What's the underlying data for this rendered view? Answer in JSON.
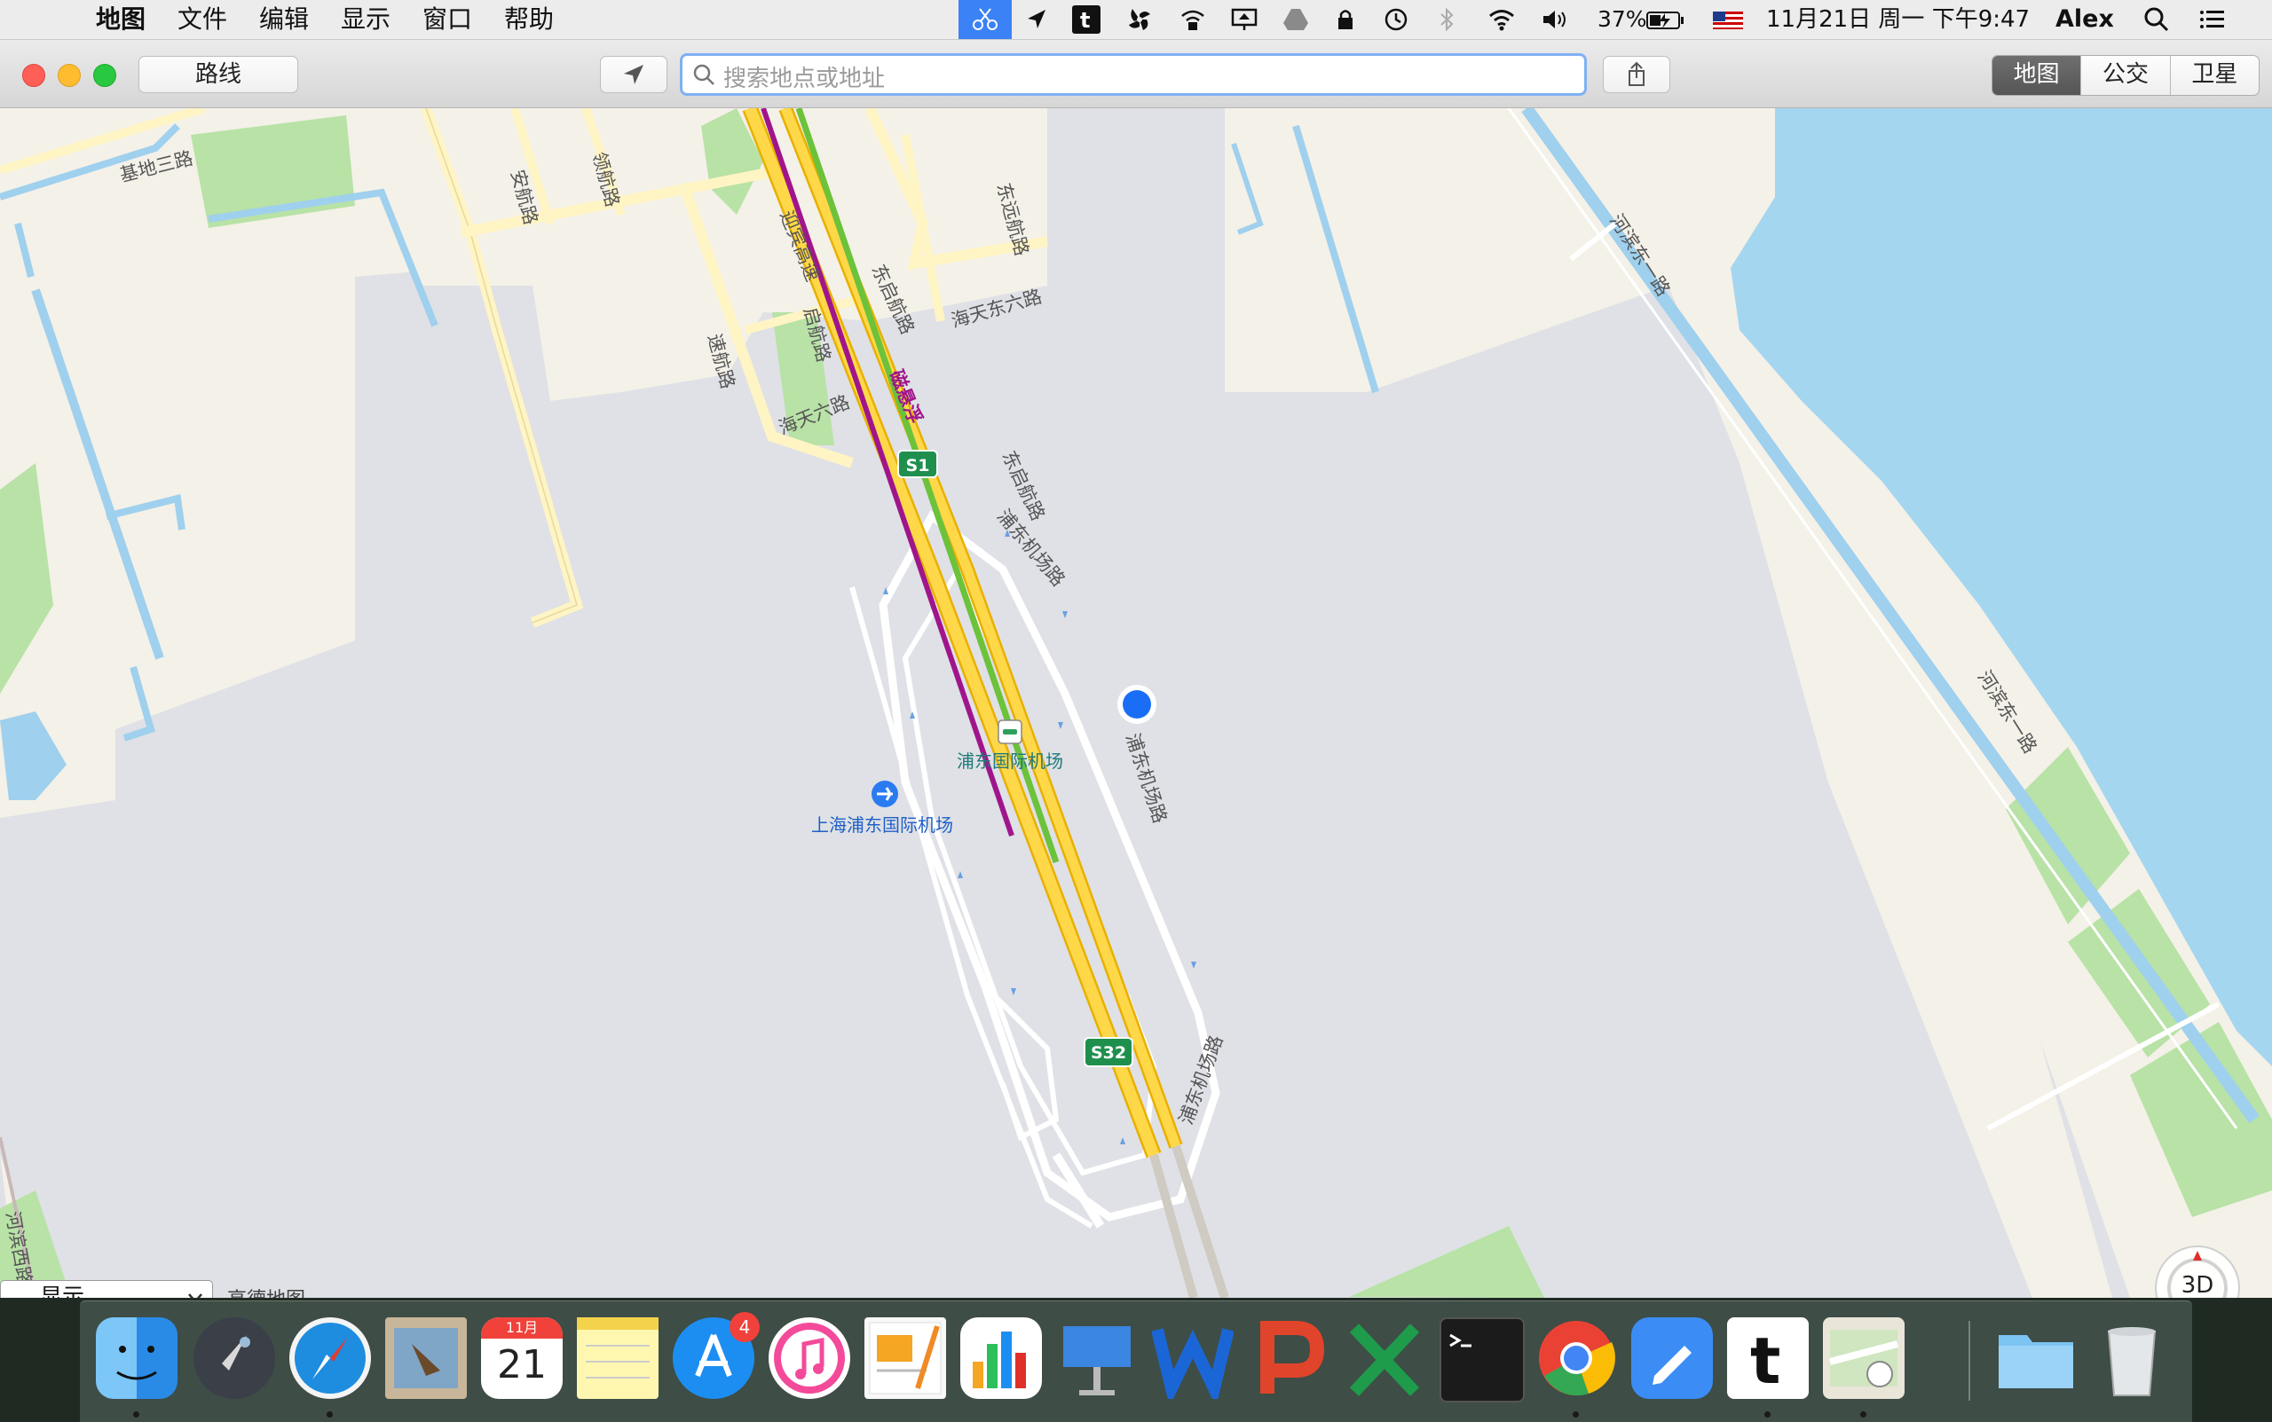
{
  "menubar": {
    "apple_glyph": "",
    "menus": [
      "地图",
      "文件",
      "编辑",
      "显示",
      "窗口",
      "帮助"
    ],
    "status_icons": [
      "scissors-icon",
      "location-arrow-icon",
      "t-app-icon",
      "gear-fan-icon",
      "wifi-lock-icon",
      "screen-share-icon",
      "drive-icon",
      "lock-icon",
      "time-machine-icon",
      "bluetooth-icon",
      "wifi-icon",
      "volume-icon"
    ],
    "battery": "37%",
    "flag_icon": "us-flag-icon",
    "datetime": "11月21日 周一 下午9:47",
    "user": "Alex",
    "spotlight_icon": "search-icon",
    "notification_icon": "list-icon"
  },
  "toolbar": {
    "directions_label": "路线",
    "search_placeholder": "搜索地点或地址",
    "map_modes": [
      "地图",
      "公交",
      "卫星"
    ],
    "selected_mode": "地图"
  },
  "map": {
    "labels": [
      {
        "text": "基地三路"
      },
      {
        "text": "安航路"
      },
      {
        "text": "领航路"
      },
      {
        "text": "迎宾高速"
      },
      {
        "text": "东启航路"
      },
      {
        "text": "东远航路"
      },
      {
        "text": "启航路"
      },
      {
        "text": "速航路"
      },
      {
        "text": "海天东六路"
      },
      {
        "text": "磁悬浮"
      },
      {
        "text": "海天六路"
      },
      {
        "text": "东启航路"
      },
      {
        "text": "浦东机场路"
      },
      {
        "text": "浦东机场路"
      },
      {
        "text": "浦东机场路"
      },
      {
        "text": "河滨东一路"
      },
      {
        "text": "河滨东一路"
      },
      {
        "text": "河滨西路"
      }
    ],
    "highway_shields": [
      "S1",
      "S32"
    ],
    "poi_metro": "浦东国际机场",
    "poi_airport": "上海浦东国际机场",
    "compass_label": "3D",
    "zoom_minus": "−",
    "zoom_plus": "+",
    "attribution_select": "显示",
    "attribution_text": "高德地图"
  },
  "dock": {
    "apps": [
      "finder-icon",
      "launchpad-icon",
      "safari-icon",
      "mail-icon",
      "calendar-icon",
      "notes-icon",
      "app-store-icon",
      "itunes-icon",
      "pages-icon",
      "numbers-icon",
      "keynote-icon",
      "word-icon",
      "powerpoint-icon",
      "excel-icon",
      "terminal-icon",
      "chrome-icon",
      "pen-app-icon",
      "t-app-icon",
      "maps-icon",
      "folder-icon",
      "trash-icon"
    ],
    "calendar_month": "11月",
    "calendar_day": "21",
    "app_store_badge": "4"
  }
}
